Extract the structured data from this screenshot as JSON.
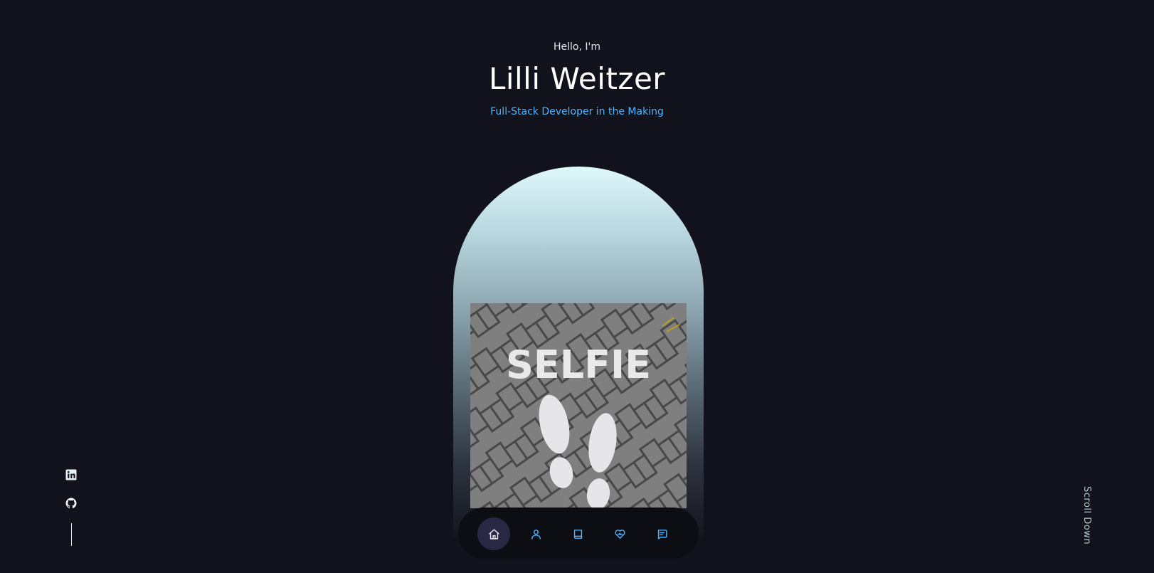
{
  "hero": {
    "greeting": "Hello, I'm",
    "name": "Lilli Weitzer",
    "tagline": "Full-Stack Developer in the Making"
  },
  "photo": {
    "text": "SELFIE",
    "alt_icon": "selfie-footprints-image"
  },
  "nav": {
    "items": [
      {
        "icon": "home-icon",
        "active": true
      },
      {
        "icon": "user-icon",
        "active": false
      },
      {
        "icon": "book-icon",
        "active": false
      },
      {
        "icon": "heart-icon",
        "active": false
      },
      {
        "icon": "message-icon",
        "active": false
      }
    ]
  },
  "socials": {
    "items": [
      {
        "icon": "linkedin-icon"
      },
      {
        "icon": "github-icon"
      }
    ]
  },
  "scroll": {
    "label": "Scroll Down"
  },
  "colors": {
    "background": "#12121c",
    "accent": "#4db5ff",
    "dock": "#0d0d14",
    "active_nav": "#2a2745"
  }
}
